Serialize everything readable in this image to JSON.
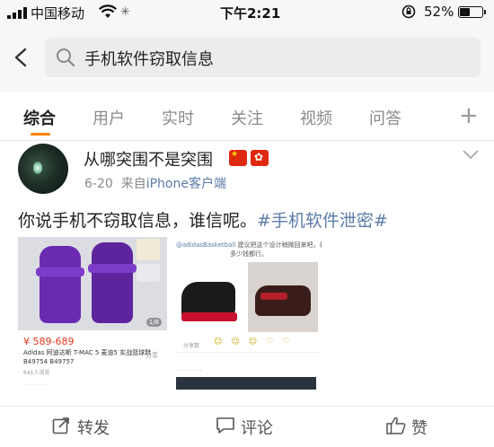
{
  "status_bar": {
    "carrier": "中国移动",
    "time": "下午2:21",
    "battery_percent": "52%",
    "battery_level": 0.52
  },
  "search": {
    "query": "手机软件窃取信息"
  },
  "tabs": [
    {
      "label": "综合",
      "active": true
    },
    {
      "label": "用户",
      "active": false
    },
    {
      "label": "实时",
      "active": false
    },
    {
      "label": "关注",
      "active": false
    },
    {
      "label": "视频",
      "active": false
    },
    {
      "label": "问答",
      "active": false
    }
  ],
  "tab_more_label": "+",
  "post": {
    "username": "从哪突围不是突围",
    "date": "6-20",
    "source_prefix": "来自",
    "source": "iPhone客户端",
    "text": "你说手机不窃取信息，谁信呢。",
    "hashtag": "#手机软件泄密#"
  },
  "left_screenshot": {
    "price": "¥ 589-689",
    "title": "Adidas 阿迪达斯 T-MAC 5 麦迪5 实战篮球鞋 B49754 B49757",
    "share": "分享",
    "stats": "641人浏览",
    "page_badge": "1/8"
  },
  "right_screenshot": {
    "handle": "@adidasBasketball",
    "text_line1": "建议把这个设计稍微回来吧，花",
    "text_line2": "多少钱都行。",
    "share": "分享数"
  },
  "actions": {
    "repost": "转发",
    "comment": "评论",
    "like": "赞"
  },
  "colors": {
    "accent": "#ff8200",
    "link": "#5b7ba8",
    "price": "#e4391c"
  }
}
